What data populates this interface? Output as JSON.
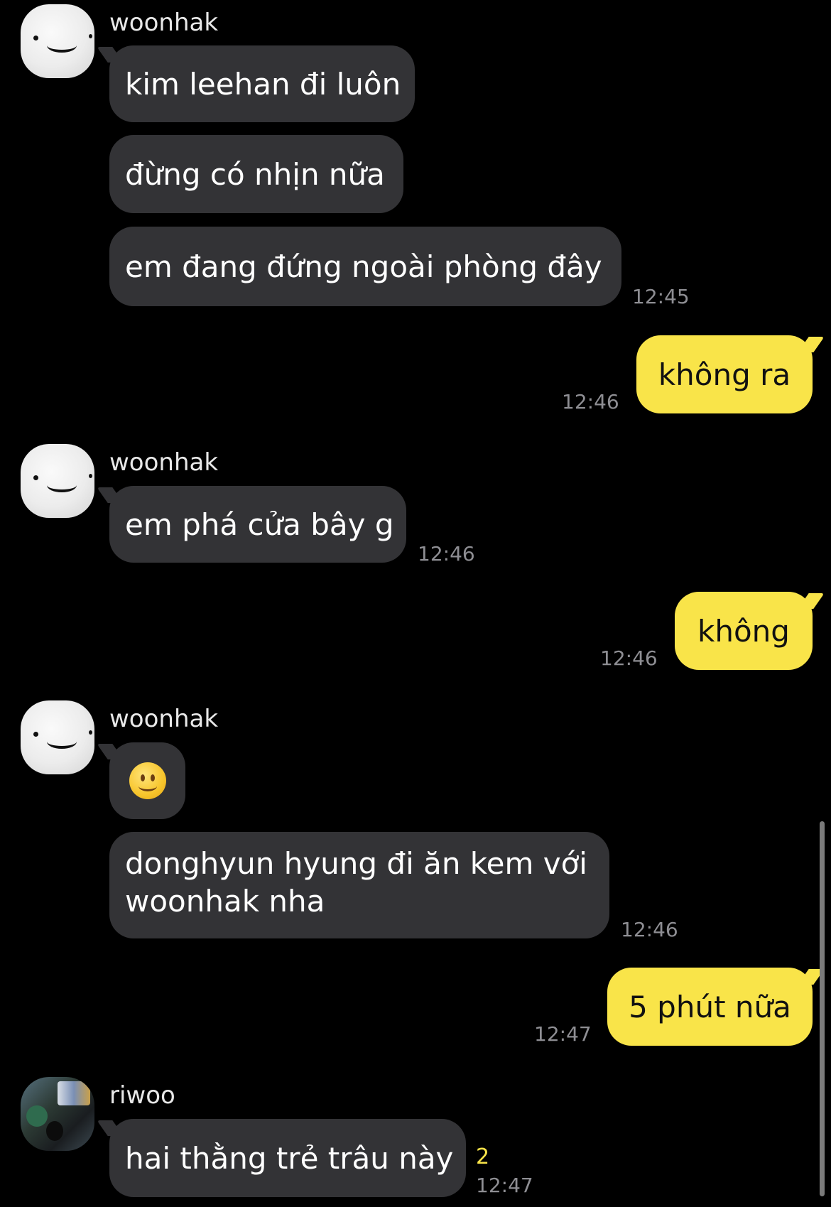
{
  "messages": {
    "g1": {
      "sender": "woonhak",
      "b1": "kim leehan đi luôn",
      "b2": "đừng có nhịn nữa",
      "b3": "em đang đứng ngoài phòng đây",
      "time": "12:45"
    },
    "o1": {
      "text": "không ra",
      "time": "12:46"
    },
    "g2": {
      "sender": "woonhak",
      "b1": "em phá cửa bây g",
      "time": "12:46"
    },
    "o2": {
      "text": "không",
      "time": "12:46"
    },
    "g3": {
      "sender": "woonhak",
      "b1_emoji": "slightly-smiling-face",
      "b2": "donghyun hyung đi ăn kem với woonhak nha",
      "time": "12:46"
    },
    "o3": {
      "text": "5 phút nữa",
      "time": "12:47"
    },
    "g4": {
      "sender": "riwoo",
      "b1": "hai thằng trẻ trâu này",
      "unread": "2",
      "time": "12:47"
    }
  },
  "colors": {
    "background": "#000000",
    "incoming_bubble": "#333336",
    "outgoing_bubble": "#f9e449",
    "timestamp": "#8e8e93",
    "unread_count": "#f9e449"
  }
}
